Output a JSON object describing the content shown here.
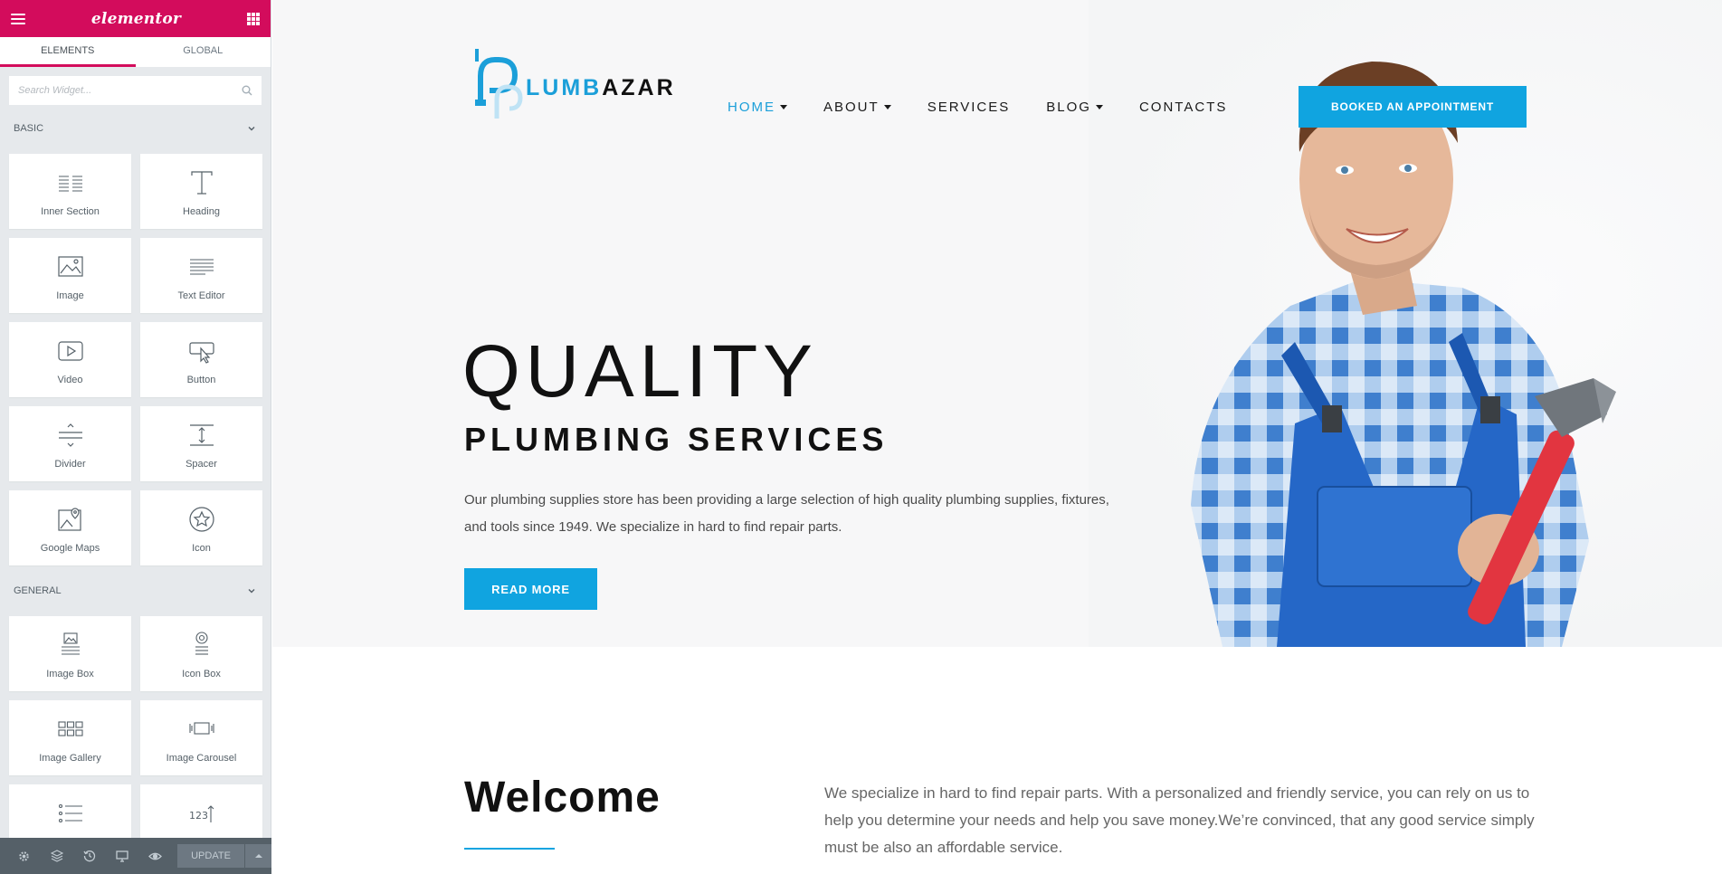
{
  "colors": {
    "elementor_pink": "#d30c5c",
    "accent_blue": "#10a4e0",
    "panel_bg": "#e6e9ec",
    "footer_bg": "#556068"
  },
  "panel": {
    "brand": "elementor",
    "tabs": [
      "ELEMENTS",
      "GLOBAL"
    ],
    "active_tab": "ELEMENTS",
    "search_placeholder": "Search Widget...",
    "categories": [
      {
        "title": "BASIC",
        "widgets": [
          {
            "label": "Inner Section",
            "icon": "inner-section-icon"
          },
          {
            "label": "Heading",
            "icon": "heading-icon"
          },
          {
            "label": "Image",
            "icon": "image-icon"
          },
          {
            "label": "Text Editor",
            "icon": "text-editor-icon"
          },
          {
            "label": "Video",
            "icon": "video-icon"
          },
          {
            "label": "Button",
            "icon": "button-icon"
          },
          {
            "label": "Divider",
            "icon": "divider-icon"
          },
          {
            "label": "Spacer",
            "icon": "spacer-icon"
          },
          {
            "label": "Google Maps",
            "icon": "google-maps-icon"
          },
          {
            "label": "Icon",
            "icon": "star-icon"
          }
        ]
      },
      {
        "title": "GENERAL",
        "widgets": [
          {
            "label": "Image Box",
            "icon": "image-box-icon"
          },
          {
            "label": "Icon Box",
            "icon": "icon-box-icon"
          },
          {
            "label": "Image Gallery",
            "icon": "image-gallery-icon"
          },
          {
            "label": "Image Carousel",
            "icon": "image-carousel-icon"
          },
          {
            "label": "",
            "icon": "icon-list-icon"
          },
          {
            "label": "",
            "icon": "counter-icon"
          }
        ]
      }
    ],
    "footer": {
      "update_label": "UPDATE",
      "icons": [
        "settings-icon",
        "navigator-icon",
        "history-icon",
        "responsive-icon",
        "preview-icon"
      ]
    }
  },
  "site": {
    "logo": {
      "first": "LUMB",
      "second": "AZAR"
    },
    "nav": [
      {
        "label": "HOME",
        "dropdown": true,
        "active": true
      },
      {
        "label": "ABOUT",
        "dropdown": true,
        "active": false
      },
      {
        "label": "SERVICES",
        "dropdown": false,
        "active": false
      },
      {
        "label": "BLOG",
        "dropdown": true,
        "active": false
      },
      {
        "label": "CONTACTS",
        "dropdown": false,
        "active": false
      }
    ],
    "appointment_button": "BOOKED AN APPOINTMENT",
    "hero": {
      "title": "QUALITY",
      "subtitle": "PLUMBING SERVICES",
      "text": "Our plumbing supplies store has been providing a large selection of high quality plumbing supplies, fixtures, and tools since 1949. We specialize in hard to find repair parts.",
      "button": "READ MORE"
    },
    "welcome": {
      "title": "Welcome",
      "text": "We specialize in hard to find repair parts. With a personalized and friendly service, you can rely on us to help you determine your needs and help you save money.We’re convinced, that any good service simply must be also an affordable service."
    }
  }
}
